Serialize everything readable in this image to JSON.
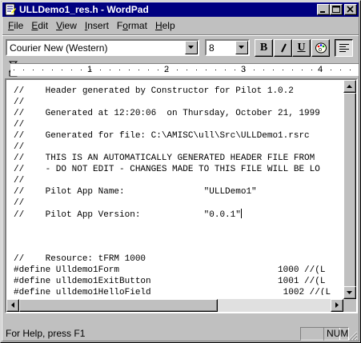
{
  "window": {
    "title": "ULLDemo1_res.h - WordPad"
  },
  "title_buttons": [
    "minimize-icon",
    "maximize-icon",
    "close-icon"
  ],
  "menu": [
    {
      "underline": "F",
      "rest": "ile"
    },
    {
      "underline": "E",
      "rest": "dit"
    },
    {
      "underline": "V",
      "rest": "iew"
    },
    {
      "underline": "I",
      "rest": "nsert"
    },
    {
      "pre": "F",
      "underline": "o",
      "rest": "rmat"
    },
    {
      "underline": "H",
      "rest": "elp"
    }
  ],
  "toolbar": {
    "font_name": "Courier New (Western)",
    "font_size": "8",
    "bold_label": "B",
    "italic_label": "I",
    "underline_label": "U",
    "color_icon": "color-palette-icon",
    "align_icon": "align-left-icon"
  },
  "ruler": {
    "numbers": [
      "1",
      "2",
      "3",
      "4"
    ]
  },
  "document": {
    "lines": [
      "//    Header generated by Constructor for Pilot 1.0.2",
      "//",
      "//    Generated at 12:20:06  on Thursday, October 21, 1999",
      "//",
      "//    Generated for file: C:\\AMISC\\ull\\Src\\ULLDemo1.rsrc",
      "//",
      "//    THIS IS AN AUTOMATICALLY GENERATED HEADER FILE FROM",
      "//    - DO NOT EDIT - CHANGES MADE TO THIS FILE WILL BE LO",
      "//",
      "//    Pilot App Name:               \"ULLDemo1\"",
      "//",
      "//    Pilot App Version:            \"0.0.1\"",
      "",
      "",
      "",
      "//    Resource: tFRM 1000",
      "#define Ulldemo1Form                              1000 //(L",
      "#define ulldemo1ExitButton                        1001 //(L",
      "#define ulldemo1HelloField                         1002 //(L"
    ],
    "caret_line": 11
  },
  "status": {
    "help_text": "For Help, press F1",
    "num_indicator": "NUM"
  }
}
